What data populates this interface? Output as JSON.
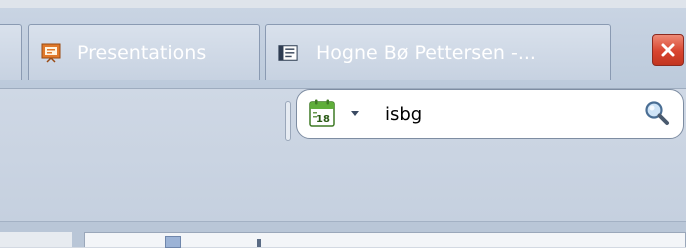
{
  "tabs": [
    {
      "label": "Presentations",
      "icon": "presentation-icon"
    },
    {
      "label": "Hogne Bø Pettersen -...",
      "icon": "document-icon"
    }
  ],
  "window": {
    "close_icon": "close-icon"
  },
  "search": {
    "value": "isbg",
    "calendar_icon": "calendar-icon",
    "calendar_day": "18",
    "dropdown_icon": "dropdown-arrow-icon",
    "search_icon": "search-icon"
  },
  "colors": {
    "close_red": "#d8442f",
    "calendar_green": "#5fae3a",
    "presentation_orange": "#e0792b"
  }
}
